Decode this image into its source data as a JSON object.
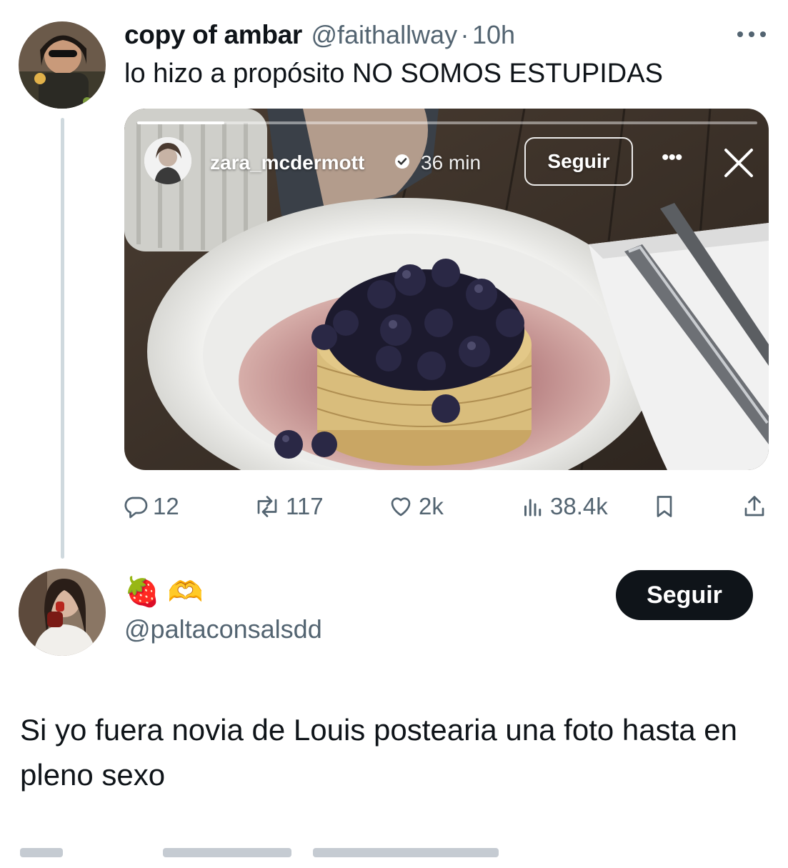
{
  "tweet": {
    "author_name": "copy of ambar",
    "author_handle": "@faithallway",
    "separator": "·",
    "time": "10h",
    "more_icon": "more-horizontal-icon",
    "text": "lo hizo a propósito NO SOMOS ESTUPIDAS",
    "story": {
      "username": "zara_mcdermott",
      "time": "36 min",
      "follow_label": "Seguir",
      "more_label": "•••",
      "progress_fraction": 0.14
    },
    "actions": {
      "replies": "12",
      "retweets": "117",
      "likes": "2k",
      "views": "38.4k"
    }
  },
  "reply": {
    "display_name_emojis": "🍓 🫶",
    "handle": "@paltaconsalsdd",
    "follow_label": "Seguir",
    "text": "Si yo fuera novia de Louis postearia una foto hasta en pleno sexo"
  },
  "colors": {
    "text_primary": "#0f1419",
    "text_secondary": "#536471",
    "thread_line": "#cfd9de",
    "follow_button_bg": "#0f1419"
  }
}
